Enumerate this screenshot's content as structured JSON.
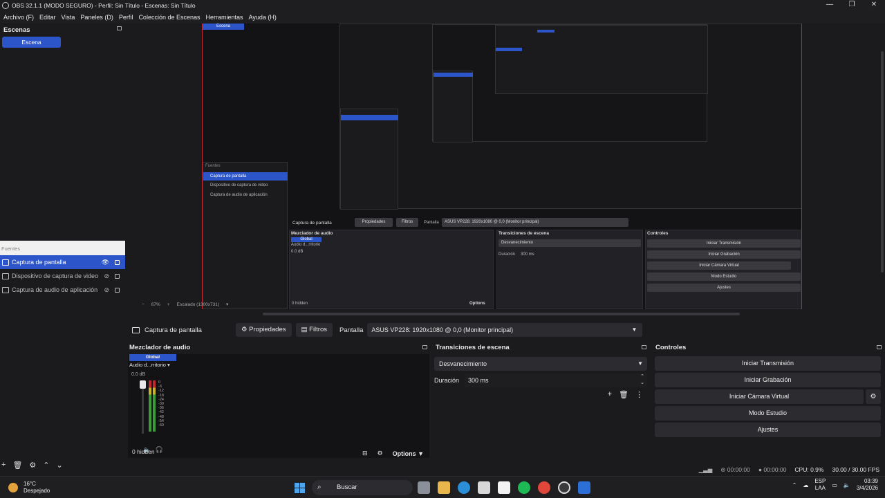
{
  "window": {
    "title": "OBS 32.1.1 (MODO SEGURO) - Perfil: Sin Título - Escenas: Sin Título",
    "controls": [
      "—",
      "❐",
      "✕"
    ]
  },
  "menu": [
    "Archivo (F)",
    "Editar",
    "Vista",
    "Paneles (D)",
    "Perfil",
    "Colección de Escenas",
    "Herramientas",
    "Ayuda (H)"
  ],
  "scenes": {
    "title": "Escenas",
    "items": [
      "Escena"
    ]
  },
  "sources": {
    "header": "Fuentes",
    "items": [
      {
        "label": "Captura de pantalla",
        "active": true
      },
      {
        "label": "Dispositivo de captura de video",
        "active": false
      },
      {
        "label": "Captura de audio de aplicación",
        "active": false
      }
    ],
    "toolbar": [
      "+",
      "🗑",
      "⚙",
      "⌃",
      "⌄"
    ]
  },
  "preview": {
    "scene_tag": "Escena",
    "zoom": "67%",
    "scale": "Escalado (1300x731)",
    "nested_sources": [
      "Captura de pantalla",
      "Dispositivo de captura de video",
      "Captura de audio de aplicación"
    ],
    "nested_header": "Fuentes",
    "nested": {
      "context_name": "Captura de pantalla",
      "props": "Propiedades",
      "filters": "Filtros",
      "display_label": "Pantalla",
      "display_value": "ASUS VP228: 1920x1080 @ 0,0 (Monitor principal)",
      "mixer_title": "Mezclador de audio",
      "global": "Global",
      "audio_name": "Audio d...rritorio",
      "db": "0.0 dB",
      "hidden": "0 hidden",
      "options": "Options",
      "trans_title": "Transiciones de escena",
      "fade": "Desvanecimiento",
      "dur_label": "Duración",
      "dur_value": "300 ms",
      "ctrl_title": "Controles",
      "ctrl_buttons": [
        "Iniciar Transmisión",
        "Iniciar Grabación",
        "Iniciar Cámara Virtual",
        "Modo Estudio",
        "Ajustes"
      ]
    }
  },
  "context": {
    "source_name": "Captura de pantalla",
    "properties": "Propiedades",
    "filters": "Filtros",
    "display_label": "Pantalla",
    "display_value": "ASUS VP228: 1920x1080 @ 0,0 (Monitor principal)"
  },
  "audio": {
    "title": "Mezclador de audio",
    "global": "Global",
    "name": "Audio d...rritorio",
    "db": "0.0 dB",
    "scale": [
      "0",
      "-6",
      "-12",
      "-18",
      "-24",
      "-30",
      "-36",
      "-42",
      "-48",
      "-54",
      "-60"
    ],
    "hidden": "0 hidden",
    "options": "Options"
  },
  "transitions": {
    "title": "Transiciones de escena",
    "selected": "Desvanecimiento",
    "duration_label": "Duración",
    "duration_value": "300 ms"
  },
  "controls": {
    "title": "Controles",
    "stream": "Iniciar Transmisión",
    "record": "Iniciar Grabación",
    "virtualcam": "Iniciar Cámara Virtual",
    "studio": "Modo Estudio",
    "settings": "Ajustes"
  },
  "status": {
    "stream_time": "00:00:00",
    "rec_time": "00:00:00",
    "cpu": "CPU: 0.9%",
    "fps": "30.00 / 30.00 FPS"
  },
  "taskbar": {
    "temp": "16°C",
    "weather": "Despejado",
    "search": "Buscar",
    "lang_1": "ESP",
    "lang_2": "LAA",
    "time": "03:39",
    "date": "3/4/2026"
  },
  "colors": {
    "accent": "#2c55c9",
    "canvas_border": "#c0282d",
    "background": "#1b1b1d"
  }
}
